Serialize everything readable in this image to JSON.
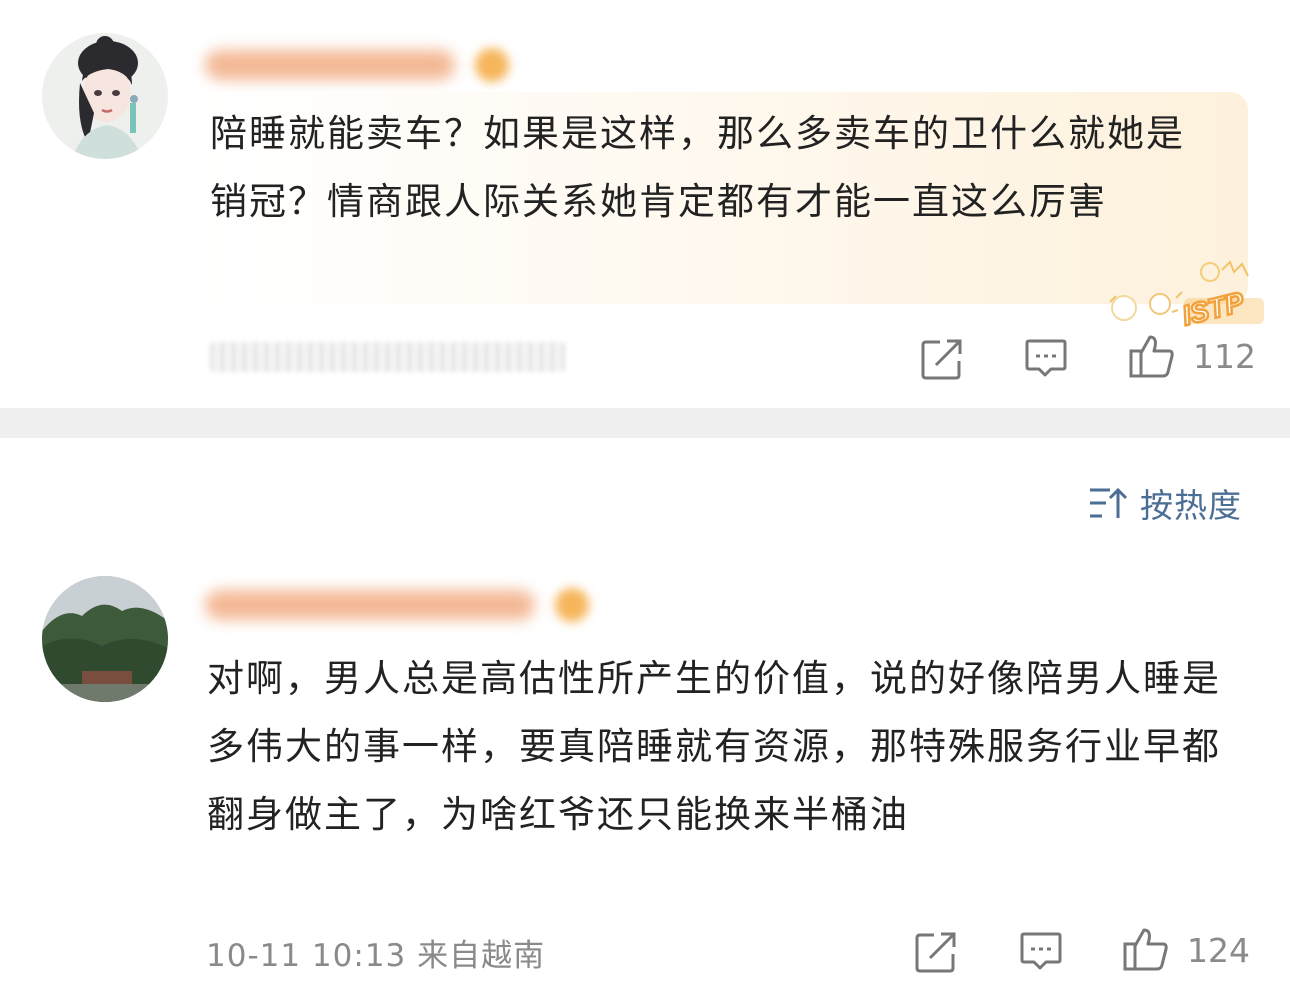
{
  "comments": [
    {
      "text": "陪睡就能卖车？如果是这样，那么多卖车的卫什么就她是销冠？情商跟人际关系她肯定都有才能一直这么厉害",
      "badge_text": "ISTP",
      "likes": "112",
      "avatar_icon": "avatar-girl-illustration"
    },
    {
      "text": "对啊，男人总是高估性所产生的价值，说的好像陪男人睡是多伟大的事一样，要真陪睡就有资源，那特殊服务行业早都翻身做主了，为啥红爷还只能换来半桶油",
      "meta": "10-11 10:13  来自越南",
      "likes": "124",
      "avatar_icon": "avatar-landscape-photo"
    }
  ],
  "sort": {
    "label": "按热度",
    "icon": "sort-icon"
  },
  "colors": {
    "accent_blue": "#4b6e95",
    "meta_gray": "#8a8a8a",
    "divider": "#f0f0f0"
  }
}
